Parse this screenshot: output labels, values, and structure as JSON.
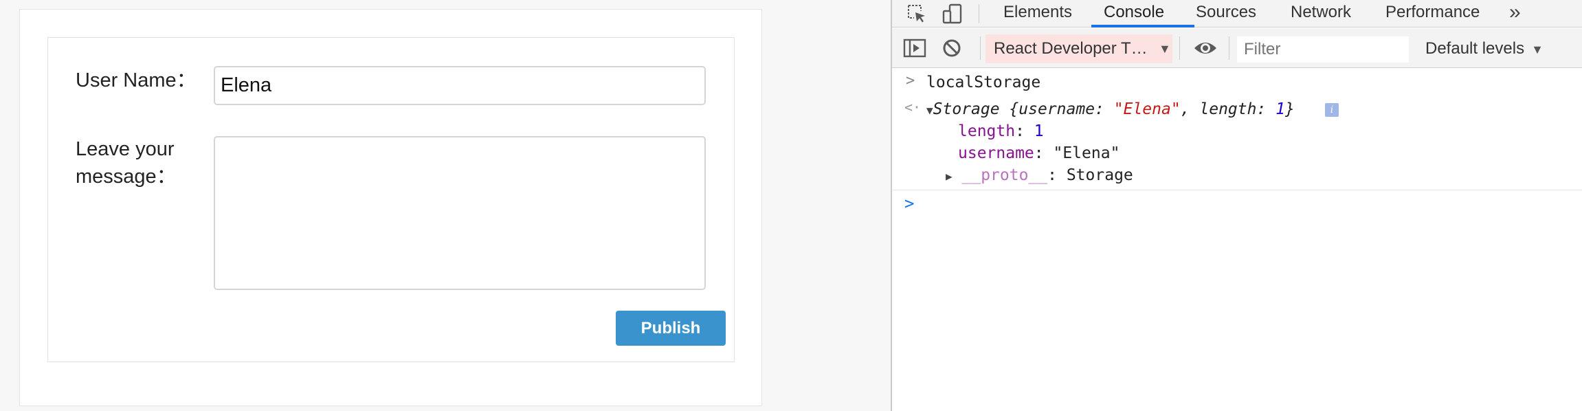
{
  "form": {
    "username_label": "User Name：",
    "username_value": "Elena",
    "message_label": "Leave your message：",
    "message_value": "",
    "publish_label": "Publish"
  },
  "devtools": {
    "tabs": [
      {
        "label": "Elements"
      },
      {
        "label": "Console",
        "active": true
      },
      {
        "label": "Sources"
      },
      {
        "label": "Network"
      },
      {
        "label": "Performance"
      }
    ],
    "more_tabs_symbol": "»",
    "icons": {
      "inspect": "inspect-element-icon",
      "device": "device-toolbar-icon",
      "sidebar": "sidebar-toggle-icon",
      "clear": "clear-console-icon",
      "eye": "live-expression-icon",
      "info": "info-icon"
    },
    "toolbar": {
      "context": "React Developer T…",
      "filter_placeholder": "Filter",
      "levels": "Default levels"
    },
    "console": {
      "input": "localStorage",
      "storage_name": "Storage",
      "storage_open": " {username: ",
      "storage_username": "\"Elena\"",
      "storage_mid": ", length: ",
      "storage_length": "1",
      "storage_close": "}",
      "prop_length_key": "length",
      "prop_length_value": "1",
      "prop_username_key": "username",
      "prop_username_value": "\"Elena\"",
      "proto_key": "__proto__",
      "proto_value": "Storage",
      "info_glyph": "i"
    },
    "colors": {
      "accent": "#1a73e8",
      "publish_button": "#3a93cd",
      "context_bg": "#fde2e2",
      "string": "#c41a16",
      "number": "#1c00cf",
      "property": "#881391"
    }
  }
}
